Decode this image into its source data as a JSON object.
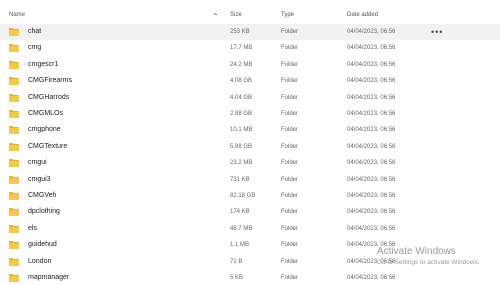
{
  "header": {
    "name": "Name",
    "size": "Size",
    "type": "Type",
    "date_added": "Date added"
  },
  "rows": [
    {
      "name": "chat",
      "size": "253 KB",
      "type": "Folder",
      "date": "04/04/2023, 06:56"
    },
    {
      "name": "cmg",
      "size": "17.7 MB",
      "type": "Folder",
      "date": "04/04/2023, 06:56"
    },
    {
      "name": "cmgescr1",
      "size": "24.2 MB",
      "type": "Folder",
      "date": "04/04/2023, 06:56"
    },
    {
      "name": "CMGFirearms",
      "size": "4.08 GB",
      "type": "Folder",
      "date": "04/04/2023, 06:56"
    },
    {
      "name": "CMGHarrods",
      "size": "4.04 GB",
      "type": "Folder",
      "date": "04/04/2023, 06:56"
    },
    {
      "name": "CMGMLOs",
      "size": "2.88 GB",
      "type": "Folder",
      "date": "04/04/2023, 06:56"
    },
    {
      "name": "cmgphone",
      "size": "10.1 MB",
      "type": "Folder",
      "date": "04/04/2023, 06:56"
    },
    {
      "name": "CMGTexture",
      "size": "5.88 GB",
      "type": "Folder",
      "date": "04/04/2023, 06:56"
    },
    {
      "name": "cmgui",
      "size": "23.2 MB",
      "type": "Folder",
      "date": "04/04/2023, 06:56"
    },
    {
      "name": "cmgui3",
      "size": "731 KB",
      "type": "Folder",
      "date": "04/04/2023, 06:56"
    },
    {
      "name": "CMGVeh",
      "size": "82.18 GB",
      "type": "Folder",
      "date": "04/04/2023, 06:56"
    },
    {
      "name": "dpclothing",
      "size": "174 KB",
      "type": "Folder",
      "date": "04/04/2023, 06:56"
    },
    {
      "name": "els",
      "size": "48.7 MB",
      "type": "Folder",
      "date": "04/04/2023, 06:56"
    },
    {
      "name": "guidehud",
      "size": "1.1 MB",
      "type": "Folder",
      "date": "04/04/2023, 06:56"
    },
    {
      "name": "London",
      "size": "71 B",
      "type": "Folder",
      "date": "04/04/2023, 06:56"
    },
    {
      "name": "mapmanager",
      "size": "5 KB",
      "type": "Folder",
      "date": "04/04/2023, 06:56"
    }
  ],
  "more_label": "•••",
  "watermark": {
    "title": "Activate Windows",
    "subtitle": "Go to Settings to activate Windows."
  },
  "colors": {
    "folder": "#f2c94c",
    "folder_dark": "#e0b43a",
    "selected_row": "#f2f2f2"
  },
  "icons": {
    "folder": "folder-icon",
    "sort": "sort-arrow-up-icon",
    "more": "more-options-icon"
  }
}
